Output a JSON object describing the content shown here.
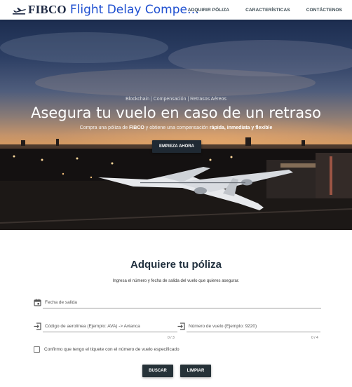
{
  "navbar": {
    "brand_fibco": "FIBCO",
    "brand_app": "Flight Delay Compe…",
    "links": [
      "ADQUIRIR PÓLIZA",
      "CARACTERÍSTICAS",
      "CONTÁCTENOS"
    ]
  },
  "hero": {
    "tagline": "Blockchain | Compensación | Retrasos Aéreos",
    "title": "Asegura tu vuelo en caso de un retraso",
    "subtitle_pre": "Compra una póliza de ",
    "subtitle_brand": "FIBCO",
    "subtitle_mid": " y obtiene una compensación ",
    "subtitle_highlight": "rápida, inmediata y flexible",
    "cta": "EMPIEZA AHORA"
  },
  "form": {
    "title": "Adquiere tu póliza",
    "description": "Ingresa el número y fecha de salida del vuelo que quieres asegurar.",
    "date_label": "Fecha de salida",
    "airline_label": "Código de aerolínea (Ejemplo: AVA) -> Avianca",
    "airline_counter": "0 / 3",
    "flight_label": "Número de vuelo (Ejemplo: 9220)",
    "flight_counter": "0 / 4",
    "checkbox_label": "Confirmo que tengo el tiquete con el número de vuelo especificado",
    "search_button": "BUSCAR",
    "clear_button": "LIMPIAR"
  },
  "icons": {
    "brand": "airplane-icon",
    "date": "calendar-icon",
    "airline": "login-icon",
    "flight": "login-icon"
  }
}
